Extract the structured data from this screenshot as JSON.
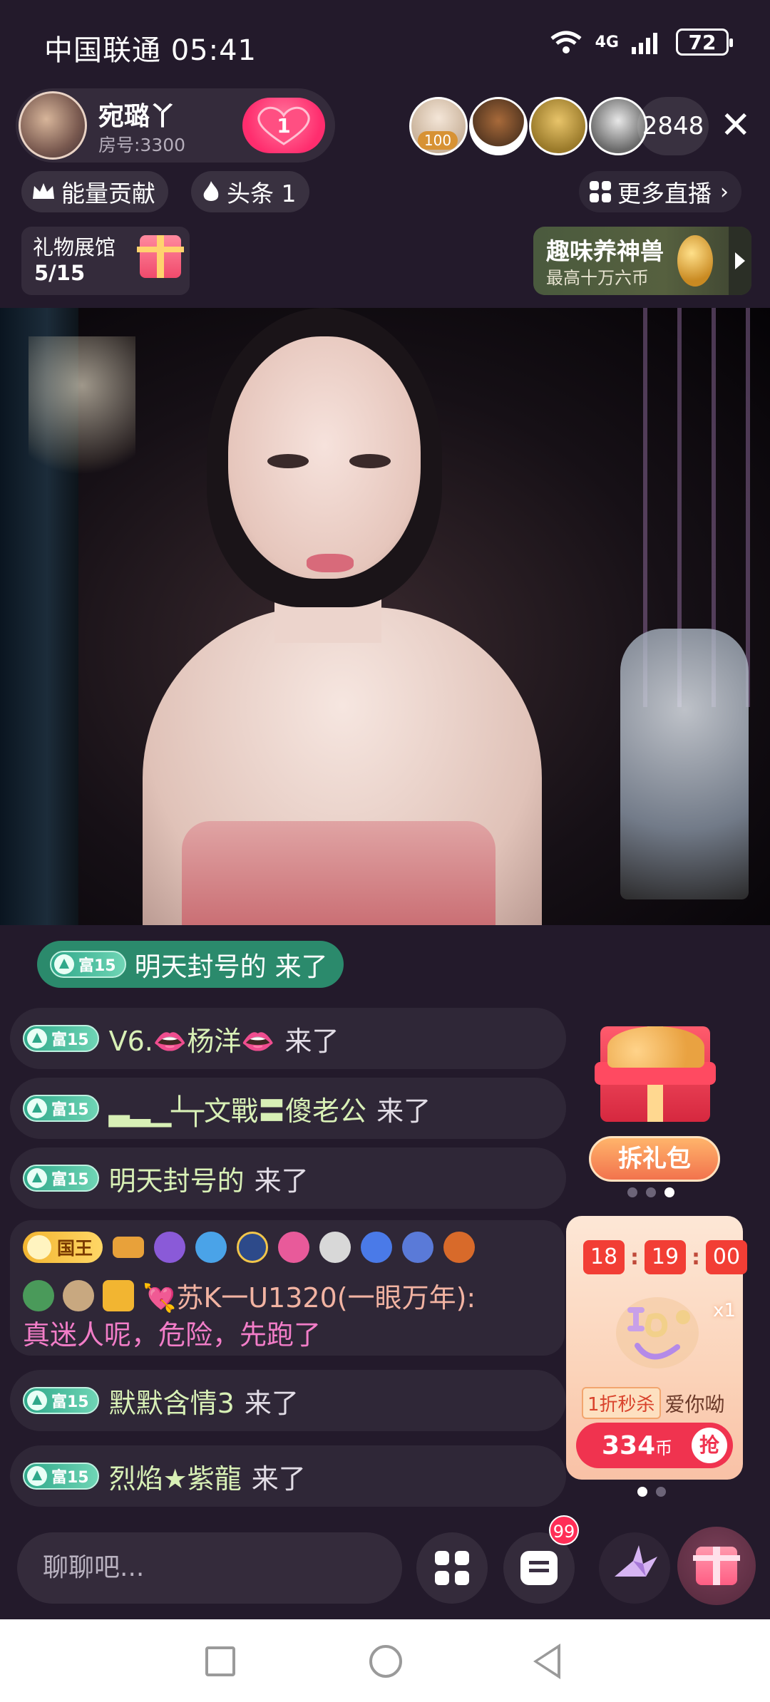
{
  "status_bar": {
    "carrier_time": "中国联通 05:41",
    "network": "4G",
    "battery": "72"
  },
  "host": {
    "name": "宛璐丫",
    "room": "房号:3300",
    "fav_count": "1"
  },
  "viewers": {
    "top_badge": "100",
    "count": "2848",
    "close": "✕"
  },
  "tags": {
    "energy": "能量贡献",
    "headline": "头条 1",
    "more_live": "更多直播"
  },
  "gift_gallery": {
    "title": "礼物展馆",
    "progress": "5/15"
  },
  "beast_promo": {
    "title": "趣味养神兽",
    "subtitle": "最高十万六币"
  },
  "chat": {
    "level_label": "富15",
    "arrived": "来了",
    "first": {
      "name": "明天封号的",
      "arrived": "来了"
    },
    "messages": [
      {
        "name": "V6.👄杨洋👄"
      },
      {
        "name": "▃▂▁┴┬文戰〓傻老公"
      },
      {
        "name": "明天封号的"
      },
      {
        "name": "默默含情3"
      },
      {
        "name": "烈焰★紫龍"
      }
    ],
    "king": {
      "badge": "国王",
      "name": "💘苏K一U1320(一眼万年):",
      "text": "真迷人呢，危险，先跑了"
    }
  },
  "gift_pack": {
    "button": "拆礼包"
  },
  "flash_sale": {
    "timer": [
      "18",
      "19",
      "00"
    ],
    "multiplier": "x1",
    "tag": "1折秒杀",
    "name": "爱你呦",
    "price": "334",
    "unit": "币",
    "grab": "抢"
  },
  "bottom_bar": {
    "input_placeholder": "聊聊吧...",
    "unread_badge": "99"
  },
  "colors": {
    "background": "#231a2b",
    "level_badge": "#2fa88a",
    "king_badge": "#f2b531",
    "chat_name": "#d8f0b6",
    "king_text": "#f27dc8",
    "sale_red": "#f0334f"
  }
}
